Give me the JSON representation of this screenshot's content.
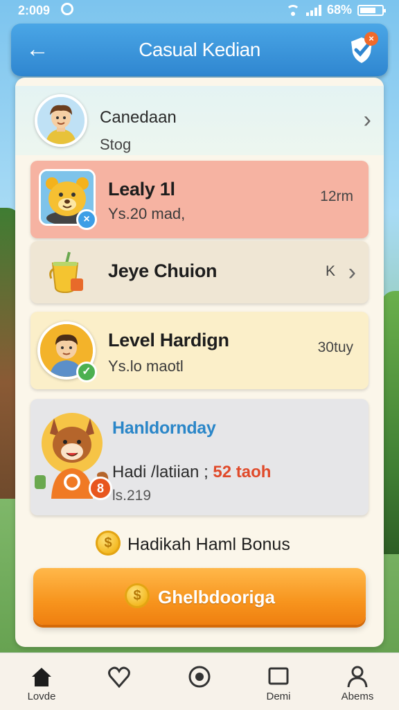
{
  "status_bar": {
    "time": "2:009",
    "battery": "68%"
  },
  "header": {
    "title": "Casual Kedian",
    "shield_badge": "×"
  },
  "profile": {
    "name": "Canedaan",
    "subtitle": "Stog"
  },
  "cards": [
    {
      "title": "Lealy 1l",
      "subtitle": "Ys.20 mad,",
      "right": "12rm"
    },
    {
      "title": "Jeye Chuion",
      "subtitle": "",
      "right": "K"
    },
    {
      "title": "Level Hardign",
      "subtitle": "Ys.lo maotl",
      "right": "30tuy"
    },
    {
      "title": "Hanldornday",
      "line1_text": "Hadi /latiian ;",
      "line1_highlight": "52 taoh",
      "line2": "ls.219",
      "badge": "8"
    }
  ],
  "bonus": {
    "text": "Hadikah Haml Bonus",
    "coin_symbol": "$"
  },
  "cta": {
    "label": "Ghelbdooriga",
    "coin_symbol": "$"
  },
  "nav": [
    {
      "label": "Lovde",
      "icon": "home-icon"
    },
    {
      "label": "",
      "icon": "heart-icon"
    },
    {
      "label": "",
      "icon": "circle-icon"
    },
    {
      "label": "Demi",
      "icon": "square-icon"
    },
    {
      "label": "Abems",
      "icon": "person-icon"
    }
  ],
  "colors": {
    "header": "#2f86d0",
    "card_highlight": "#f6b3a2",
    "card_gold": "#fbefc9",
    "cta": "#f7941d",
    "accent_text": "#2a86c8",
    "highlight_red": "#e04a2a"
  }
}
